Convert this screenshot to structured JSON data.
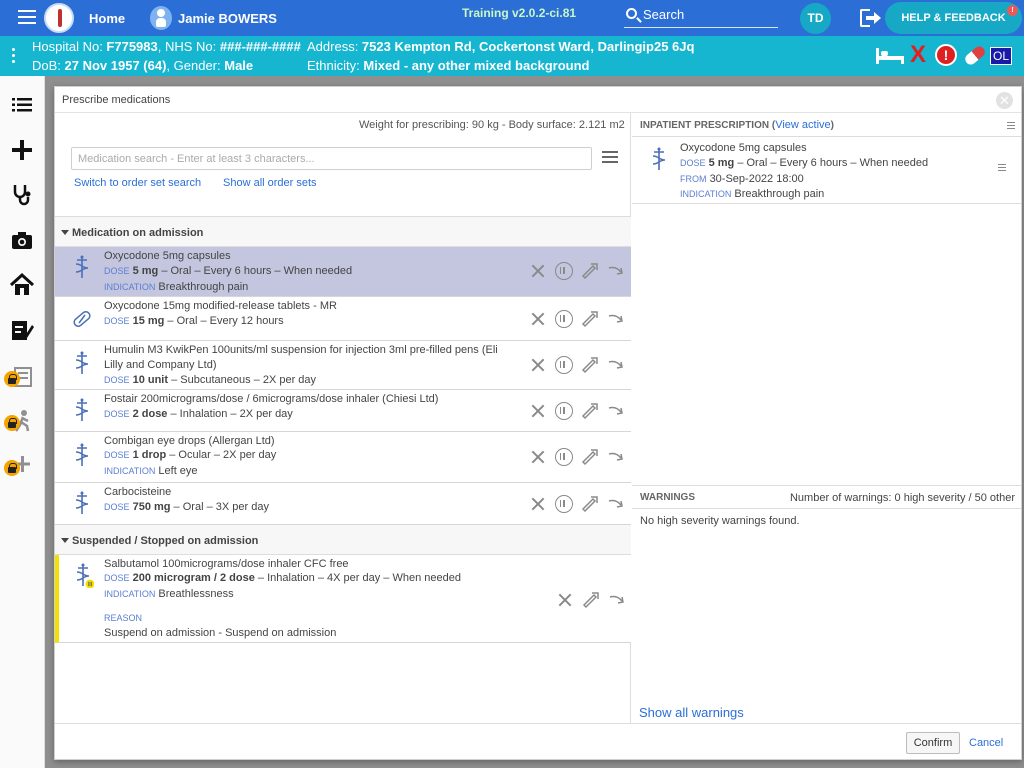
{
  "topbar": {
    "home": "Home",
    "patient_name": "Jamie BOWERS",
    "training": "Training v2.0.2-ci.81",
    "search": "Search",
    "avatar": "TD",
    "help": "HELP & FEEDBACK",
    "help_badge": "!"
  },
  "banner": {
    "line1_left": "Hospital No: ",
    "hospital_no": "F775983",
    "nhs_label": ", NHS No: ",
    "nhs_no": "###-###-####",
    "line2_left": "DoB: ",
    "dob": "27 Nov 1957 (64)",
    "gender_label": ", Gender: ",
    "gender": "Male",
    "address_label": "Address: ",
    "address": "7523 Kempton Rd, Cockertonst Ward, Darlingip25 6Jq",
    "ethnicity_label": "Ethnicity: ",
    "ethnicity": "Mixed - any other mixed background",
    "alert_glyph": "!",
    "x_glyph": "X",
    "ol_badge": "OL"
  },
  "modal": {
    "title": "Prescribe medications",
    "close": "✕",
    "weight": "Weight for prescribing: 90 kg - Body surface: 2.121 m2",
    "search_placeholder": "Medication search - Enter at least 3 characters...",
    "link_order_set": "Switch to order set search",
    "link_show_all": "Show all order sets",
    "section_admission": "Medication on admission",
    "section_suspended": "Suspended / Stopped on admission",
    "labels": {
      "dose": "DOSE",
      "indication": "INDICATION",
      "reason": "REASON",
      "from": "FROM"
    },
    "admission": [
      {
        "name": "Oxycodone 5mg capsules",
        "dose": "5 mg",
        "route": " – Oral – Every 6 hours – When needed",
        "indication": "Breakthrough pain"
      },
      {
        "name": "Oxycodone 15mg modified-release tablets - MR",
        "dose": "15 mg",
        "route": " – Oral – Every 12 hours"
      },
      {
        "name": "Humulin M3 KwikPen 100units/ml suspension for injection 3ml pre-filled pens (Eli Lilly and Company Ltd)",
        "dose": "10 unit",
        "route": " – Subcutaneous – 2X per day"
      },
      {
        "name": "Fostair 200micrograms/dose / 6micrograms/dose inhaler (Chiesi Ltd)",
        "dose": "2 dose",
        "route": " – Inhalation – 2X per day"
      },
      {
        "name": "Combigan eye drops (Allergan Ltd)",
        "dose": "1 drop",
        "route": " – Ocular – 2X per day",
        "indication": "Left eye"
      },
      {
        "name": "Carbocisteine",
        "dose": "750 mg",
        "route": " – Oral – 3X per day"
      }
    ],
    "suspended": [
      {
        "name": "Salbutamol 100micrograms/dose inhaler CFC free",
        "dose": "200 microgram / 2 dose",
        "route": " – Inhalation – 4X per day – When needed",
        "indication": "Breathlessness",
        "reason": "Suspend on admission - Suspend on admission"
      }
    ],
    "inpatient": {
      "title": "INPATIENT PRESCRIPTION",
      "view_active": "View active",
      "item": {
        "name": "Oxycodone 5mg capsules",
        "dose": "5 mg",
        "route": " – Oral – Every 6 hours – When needed",
        "from": "30-Sep-2022 18:00",
        "indication": "Breakthrough pain"
      }
    },
    "warnings": {
      "title": "WARNINGS",
      "count": "Number of warnings: 0 high severity / 50 other",
      "body": "No high severity warnings found.",
      "show_all": "Show all warnings"
    },
    "confirm": "Confirm",
    "cancel": "Cancel"
  }
}
